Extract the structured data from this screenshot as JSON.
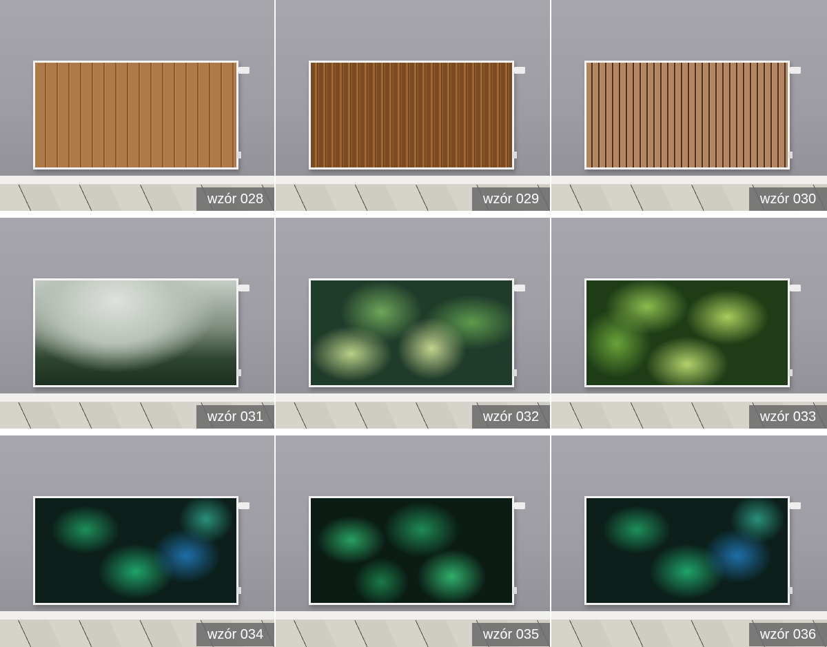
{
  "products": [
    {
      "label": "wzór 028",
      "pattern": "light oak planks"
    },
    {
      "label": "wzór 029",
      "pattern": "dark wood slats"
    },
    {
      "label": "wzór 030",
      "pattern": "thin wood slats"
    },
    {
      "label": "wzór 031",
      "pattern": "foggy forest"
    },
    {
      "label": "wzór 032",
      "pattern": "pale green leaves"
    },
    {
      "label": "wzór 033",
      "pattern": "bright green leaves"
    },
    {
      "label": "wzór 034",
      "pattern": "tropical leaves blue-green"
    },
    {
      "label": "wzór 035",
      "pattern": "tropical leaves green"
    },
    {
      "label": "wzór 036",
      "pattern": "tropical leaves teal"
    }
  ]
}
